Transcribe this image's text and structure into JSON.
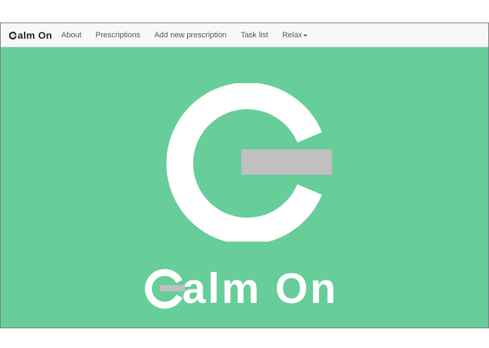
{
  "navbar": {
    "brand_letters": "alm On",
    "brand_full": "Calm On",
    "items": [
      {
        "label": "About"
      },
      {
        "label": "Prescriptions"
      },
      {
        "label": "Add new prescription"
      },
      {
        "label": "Task list"
      },
      {
        "label": "Relax",
        "has_dropdown": true
      }
    ]
  },
  "hero": {
    "wordmark_letters": "alm On"
  },
  "colors": {
    "background": "#67cd99",
    "logo_ring": "#ffffff",
    "logo_bar": "#c0c0c0",
    "navbar_bg": "#f8f8f8"
  },
  "icons": {
    "logo": "c-ring-with-bar-icon",
    "relax_dropdown": "caret-down-icon"
  }
}
